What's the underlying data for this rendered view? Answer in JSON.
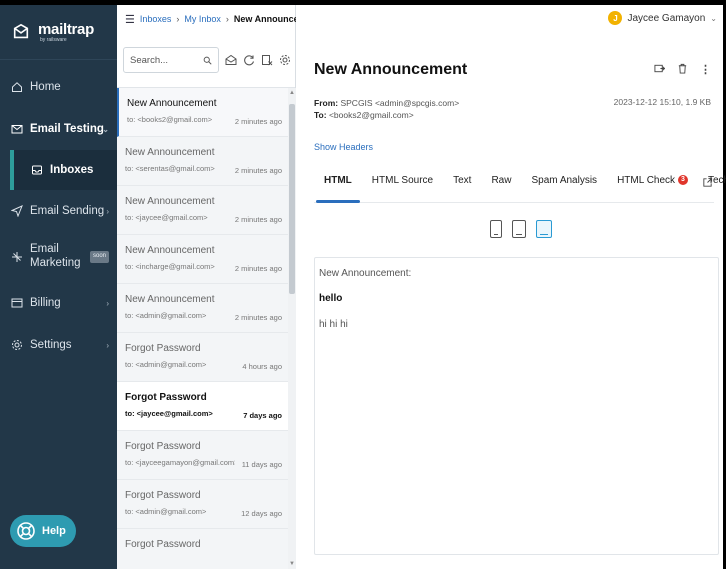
{
  "sidebar": {
    "logo_text": "mailtrap",
    "logo_subtext": "by railsware",
    "items": [
      {
        "label": "Home"
      },
      {
        "label": "Email Testing"
      },
      {
        "label": "Inboxes"
      },
      {
        "label": "Email Sending"
      },
      {
        "label": "Email Marketing",
        "badge": "soon"
      },
      {
        "label": "Billing"
      },
      {
        "label": "Settings"
      }
    ],
    "help_label": "Help"
  },
  "breadcrumb": {
    "inboxes": "Inboxes",
    "sep": "›",
    "my_inbox": "My Inbox",
    "current": "New Announcement"
  },
  "search": {
    "placeholder": "Search..."
  },
  "messages": [
    {
      "subject": "New Announcement",
      "to": "to: <books2@gmail.com>",
      "time": "2 minutes ago"
    },
    {
      "subject": "New Announcement",
      "to": "to: <serentas@gmail.com>",
      "time": "2 minutes ago"
    },
    {
      "subject": "New Announcement",
      "to": "to: <jaycee@gmail.com>",
      "time": "2 minutes ago"
    },
    {
      "subject": "New Announcement",
      "to": "to: <incharge@gmail.com>",
      "time": "2 minutes ago"
    },
    {
      "subject": "New Announcement",
      "to": "to: <admin@gmail.com>",
      "time": "2 minutes ago"
    },
    {
      "subject": "Forgot Password",
      "to": "to: <admin@gmail.com>",
      "time": "4 hours ago"
    },
    {
      "subject": "Forgot Password",
      "to": "to: <jaycee@gmail.com>",
      "time": "7 days ago"
    },
    {
      "subject": "Forgot Password",
      "to": "to: <jayceegamayon@gmail.com>",
      "time": "11 days ago"
    },
    {
      "subject": "Forgot Password",
      "to": "to: <admin@gmail.com>",
      "time": "12 days ago"
    },
    {
      "subject": "Forgot Password",
      "to": "",
      "time": ""
    }
  ],
  "user": {
    "initial": "J",
    "name": "Jaycee Gamayon"
  },
  "detail": {
    "title": "New Announcement",
    "from_label": "From:",
    "from_value": "SPCGIS <admin@spcgis.com>",
    "to_label": "To:",
    "to_value": "<books2@gmail.com>",
    "date_size": "2023-12-12 15:10, 1.9 KB",
    "show_headers": "Show Headers",
    "tabs": [
      {
        "label": "HTML"
      },
      {
        "label": "HTML Source"
      },
      {
        "label": "Text"
      },
      {
        "label": "Raw"
      },
      {
        "label": "Spam Analysis"
      },
      {
        "label": "HTML Check",
        "count": "3"
      },
      {
        "label": "Tech Info"
      }
    ],
    "body_line1": "New Announcement:",
    "body_line2": "hello",
    "body_line3": "hi hi hi"
  },
  "colors": {
    "sidebar_bg": "#223748",
    "accent": "#2a6ebd",
    "help_btn": "#2e9bb1",
    "avatar": "#f2b200",
    "badge_red": "#e0352b"
  }
}
